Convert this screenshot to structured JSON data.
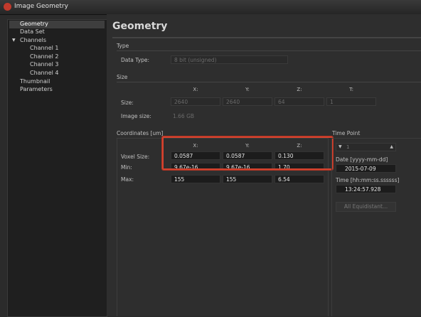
{
  "window": {
    "title": "Image Geometry"
  },
  "sidebar": {
    "items": [
      {
        "label": "Geometry"
      },
      {
        "label": "Data Set"
      },
      {
        "label": "Channels"
      },
      {
        "label": "Channel 1"
      },
      {
        "label": "Channel 2"
      },
      {
        "label": "Channel 3"
      },
      {
        "label": "Channel 4"
      },
      {
        "label": "Thumbnail"
      },
      {
        "label": "Parameters"
      }
    ]
  },
  "page": {
    "title": "Geometry"
  },
  "type_section": {
    "title": "Type",
    "data_type_label": "Data Type:",
    "data_type_value": "8 bit (unsigned)"
  },
  "size_section": {
    "title": "Size",
    "headers": [
      "X:",
      "Y:",
      "Z:",
      "T:"
    ],
    "size_label": "Size:",
    "size_values": [
      "2640",
      "2640",
      "64",
      "1"
    ],
    "image_size_label": "Image size:",
    "image_size_value": "1.66 GB"
  },
  "coordinates_section": {
    "title": "Coordinates [um]",
    "headers": [
      "X:",
      "Y:",
      "Z:"
    ],
    "voxel_label": "Voxel Size:",
    "voxel_values": [
      "0.0587",
      "0.0587",
      "0.130"
    ],
    "min_label": "Min:",
    "min_values": [
      "9.67e-16",
      "9.67e-16",
      "1.70"
    ],
    "max_label": "Max:",
    "max_values": [
      "155",
      "155",
      "6.54"
    ]
  },
  "time_section": {
    "title": "Time Point",
    "index_value": "1",
    "date_label": "Date [yyyy-mm-dd]",
    "date_value": "2015-07-09",
    "time_label": "Time [hh:mm:ss.ssssss]",
    "time_value": "13:24:57.928",
    "all_equidistant_label": "All Equidistant..."
  }
}
